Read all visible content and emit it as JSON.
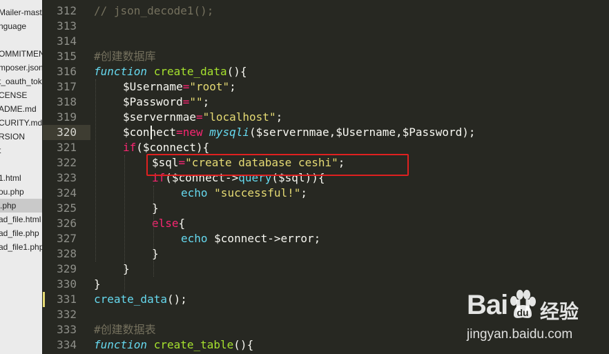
{
  "sidebar": {
    "files": [
      {
        "label": "Mailer-maste",
        "active": false
      },
      {
        "label": "nguage",
        "active": false
      },
      {
        "label": "",
        "active": false
      },
      {
        "label": "OMMITMENT",
        "active": false
      },
      {
        "label": "mposer.json",
        "active": false
      },
      {
        "label": "t_oauth_tok",
        "active": false
      },
      {
        "label": "CENSE",
        "active": false
      },
      {
        "label": "ADME.md",
        "active": false
      },
      {
        "label": "CURITY.md",
        "active": false
      },
      {
        "label": "RSION",
        "active": false
      },
      {
        "label": "t",
        "active": false
      },
      {
        "label": "",
        "active": false
      },
      {
        "label": "1.html",
        "active": false
      },
      {
        "label": "ou.php",
        "active": false
      },
      {
        "label": ".php",
        "active": true
      },
      {
        "label": "ad_file.html",
        "active": false
      },
      {
        "label": "ad_file.php",
        "active": false
      },
      {
        "label": "ad_file1.php",
        "active": false
      }
    ]
  },
  "editor": {
    "current_line": "320",
    "lines": [
      {
        "n": "312",
        "indent": 0,
        "tokens": [
          {
            "t": "// json_decode1();",
            "c": "c"
          }
        ]
      },
      {
        "n": "313",
        "indent": 0,
        "tokens": []
      },
      {
        "n": "314",
        "indent": 0,
        "tokens": []
      },
      {
        "n": "315",
        "indent": 0,
        "tokens": [
          {
            "t": "#创建数据库",
            "c": "c"
          }
        ]
      },
      {
        "n": "316",
        "indent": 0,
        "tokens": [
          {
            "t": "function",
            "c": "st"
          },
          {
            "t": " ",
            "c": "w"
          },
          {
            "t": "create_data",
            "c": "f"
          },
          {
            "t": "(){",
            "c": "w"
          }
        ]
      },
      {
        "n": "317",
        "indent": 1,
        "tokens": [
          {
            "t": "$Username",
            "c": "w"
          },
          {
            "t": "=",
            "c": "k"
          },
          {
            "t": "\"root\"",
            "c": "s"
          },
          {
            "t": ";",
            "c": "w"
          }
        ]
      },
      {
        "n": "318",
        "indent": 1,
        "tokens": [
          {
            "t": "$Password",
            "c": "w"
          },
          {
            "t": "=",
            "c": "k"
          },
          {
            "t": "\"\"",
            "c": "s"
          },
          {
            "t": ";",
            "c": "w"
          }
        ]
      },
      {
        "n": "319",
        "indent": 1,
        "tokens": [
          {
            "t": "$servernmae",
            "c": "w"
          },
          {
            "t": "=",
            "c": "k"
          },
          {
            "t": "\"localhost\"",
            "c": "s"
          },
          {
            "t": ";",
            "c": "w"
          }
        ]
      },
      {
        "n": "320",
        "indent": 1,
        "tokens": [
          {
            "t": "$connect",
            "c": "w"
          },
          {
            "t": "=",
            "c": "k"
          },
          {
            "t": "new",
            "c": "k"
          },
          {
            "t": " ",
            "c": "w"
          },
          {
            "t": "mysqli",
            "c": "st"
          },
          {
            "t": "($servernmae,$Username,$Password);",
            "c": "w"
          }
        ]
      },
      {
        "n": "321",
        "indent": 1,
        "tokens": [
          {
            "t": "if",
            "c": "k"
          },
          {
            "t": "($connect){",
            "c": "w"
          }
        ]
      },
      {
        "n": "322",
        "indent": 2,
        "tokens": [
          {
            "t": "$sql",
            "c": "w"
          },
          {
            "t": "=",
            "c": "k"
          },
          {
            "t": "\"create database ceshi\"",
            "c": "s"
          },
          {
            "t": ";",
            "c": "w"
          }
        ]
      },
      {
        "n": "323",
        "indent": 2,
        "tokens": [
          {
            "t": "if",
            "c": "k"
          },
          {
            "t": "($connect->",
            "c": "w"
          },
          {
            "t": "query",
            "c": "cy"
          },
          {
            "t": "($sql)){",
            "c": "w"
          }
        ]
      },
      {
        "n": "324",
        "indent": 3,
        "tokens": [
          {
            "t": "echo",
            "c": "cy"
          },
          {
            "t": " ",
            "c": "w"
          },
          {
            "t": "\"successful!\"",
            "c": "s"
          },
          {
            "t": ";",
            "c": "w"
          }
        ]
      },
      {
        "n": "325",
        "indent": 2,
        "tokens": [
          {
            "t": "}",
            "c": "w"
          }
        ]
      },
      {
        "n": "326",
        "indent": 2,
        "tokens": [
          {
            "t": "else",
            "c": "k"
          },
          {
            "t": "{",
            "c": "w"
          }
        ]
      },
      {
        "n": "327",
        "indent": 3,
        "tokens": [
          {
            "t": "echo",
            "c": "cy"
          },
          {
            "t": " $connect->error;",
            "c": "w"
          }
        ]
      },
      {
        "n": "328",
        "indent": 2,
        "tokens": [
          {
            "t": "}",
            "c": "w"
          }
        ]
      },
      {
        "n": "329",
        "indent": 1,
        "tokens": [
          {
            "t": "}",
            "c": "w"
          }
        ]
      },
      {
        "n": "330",
        "indent": 0,
        "tokens": [
          {
            "t": "}",
            "c": "w"
          }
        ]
      },
      {
        "n": "331",
        "indent": 0,
        "tokens": [
          {
            "t": "create_data",
            "c": "cy"
          },
          {
            "t": "();",
            "c": "w"
          }
        ]
      },
      {
        "n": "332",
        "indent": 0,
        "tokens": []
      },
      {
        "n": "333",
        "indent": 0,
        "tokens": [
          {
            "t": "#创建数据表",
            "c": "c"
          }
        ]
      },
      {
        "n": "334",
        "indent": 0,
        "tokens": [
          {
            "t": "function",
            "c": "st"
          },
          {
            "t": " ",
            "c": "w"
          },
          {
            "t": "create_table",
            "c": "f"
          },
          {
            "t": "(){",
            "c": "w"
          }
        ]
      }
    ]
  },
  "watermark": {
    "brand": "Bai  u",
    "cn": "经验",
    "url": "jingyan.baidu.com"
  },
  "colors": {
    "background": "#272822",
    "sidebar": "#ebebeb",
    "keyword": "#f92672",
    "string": "#e6db74",
    "function": "#a6e22e",
    "comment": "#75715e",
    "storage": "#66d9ef",
    "highlight_box": "#e02020"
  }
}
